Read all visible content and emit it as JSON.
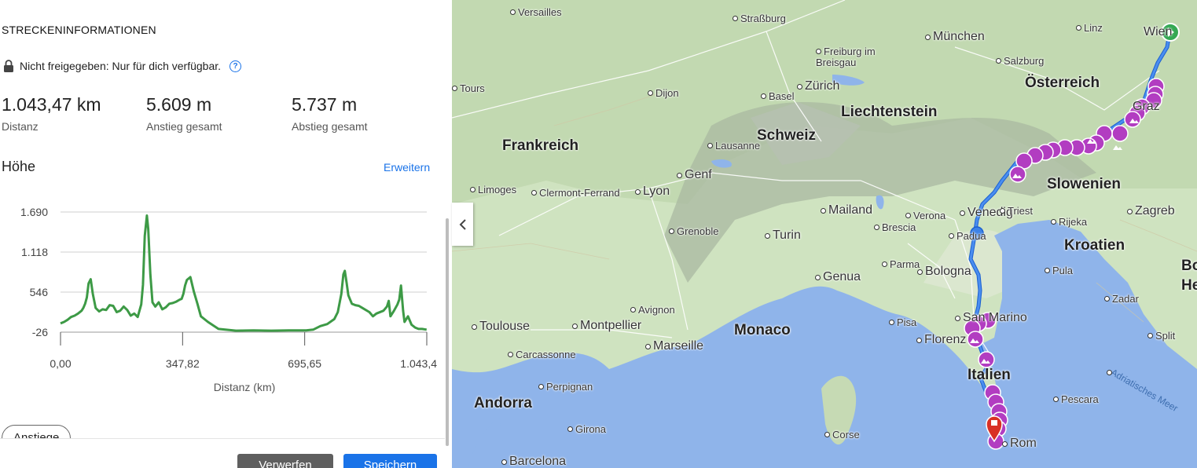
{
  "panel": {
    "section_title": "STRECKENINFORMATIONEN",
    "share_status": "Nicht freigegeben: Nur für dich verfügbar.",
    "help_icon": "?",
    "stats": [
      {
        "value": "1.043,47 km",
        "label": "Distanz"
      },
      {
        "value": "5.609 m",
        "label": "Anstieg gesamt"
      },
      {
        "value": "5.737 m",
        "label": "Abstieg gesamt"
      }
    ],
    "elevation_title": "Höhe",
    "expand_link": "Erweitern",
    "tab_climbs": "Anstiege",
    "discard_button": "Verwerfen",
    "save_button": "Speichern"
  },
  "chart_data": {
    "type": "area",
    "title": "Höhe",
    "xlabel": "Distanz (km)",
    "ylabel": "",
    "x_ticks": [
      "0,00",
      "347,82",
      "695,65",
      "1.043,4"
    ],
    "y_ticks": [
      "1.690",
      "1.118",
      "546",
      "-26"
    ],
    "xlim": [
      0,
      1043.47
    ],
    "ylim": [
      -26,
      1690
    ],
    "color": "#3d9a46",
    "series": [
      {
        "x": [
          0,
          10,
          20,
          30,
          40,
          50,
          60,
          65,
          70,
          75,
          80,
          86,
          92,
          100,
          110,
          120,
          130,
          140,
          150,
          160,
          170,
          180,
          190,
          200,
          210,
          220,
          230,
          235,
          240,
          246,
          250,
          256,
          262,
          270,
          280,
          290,
          300,
          310,
          320,
          330,
          340,
          345,
          350,
          355,
          360,
          370,
          380,
          390,
          400,
          420,
          450,
          500,
          550,
          600,
          650,
          700,
          720,
          740,
          760,
          780,
          790,
          800,
          806,
          810,
          815,
          820,
          830,
          840,
          850,
          860,
          880,
          890,
          900,
          920,
          930,
          935,
          940,
          950,
          960,
          965,
          970,
          976,
          980,
          990,
          1000,
          1010,
          1020,
          1030,
          1043
        ],
        "y": [
          100,
          120,
          150,
          190,
          210,
          240,
          280,
          320,
          380,
          470,
          670,
          730,
          520,
          320,
          270,
          300,
          290,
          360,
          350,
          260,
          280,
          340,
          290,
          210,
          240,
          190,
          370,
          650,
          1350,
          1640,
          1450,
          800,
          400,
          340,
          400,
          300,
          330,
          380,
          390,
          410,
          440,
          450,
          520,
          640,
          720,
          760,
          550,
          380,
          200,
          120,
          20,
          -5,
          0,
          -5,
          0,
          0,
          10,
          60,
          90,
          160,
          260,
          520,
          800,
          850,
          680,
          500,
          380,
          360,
          350,
          320,
          260,
          200,
          240,
          280,
          340,
          420,
          200,
          280,
          370,
          440,
          640,
          280,
          120,
          200,
          80,
          40,
          20,
          20,
          10
        ]
      }
    ]
  },
  "map": {
    "collapse_icon": "chevron-left-icon",
    "labels": [
      {
        "text": "Versailles",
        "kind": "town"
      },
      {
        "text": "Straßburg",
        "kind": "town"
      },
      {
        "text": "München",
        "kind": "city"
      },
      {
        "text": "Linz",
        "kind": "town"
      },
      {
        "text": "Wien",
        "kind": "city"
      },
      {
        "text": "Freiburg im",
        "kind": "town"
      },
      {
        "text": "Breisgau",
        "kind": "town"
      },
      {
        "text": "Salzburg",
        "kind": "town"
      },
      {
        "text": "Tours",
        "kind": "town"
      },
      {
        "text": "Dijon",
        "kind": "town"
      },
      {
        "text": "Basel",
        "kind": "town"
      },
      {
        "text": "Zürich",
        "kind": "city"
      },
      {
        "text": "Österreich",
        "kind": "country"
      },
      {
        "text": "Graz",
        "kind": "city"
      },
      {
        "text": "Liechtenstein",
        "kind": "country"
      },
      {
        "text": "Schweiz",
        "kind": "country"
      },
      {
        "text": "Frankreich",
        "kind": "country"
      },
      {
        "text": "Lausanne",
        "kind": "town"
      },
      {
        "text": "Genf",
        "kind": "city"
      },
      {
        "text": "Limoges",
        "kind": "town"
      },
      {
        "text": "Clermont-Ferrand",
        "kind": "town"
      },
      {
        "text": "Lyon",
        "kind": "city"
      },
      {
        "text": "Slowenien",
        "kind": "country"
      },
      {
        "text": "Zagreb",
        "kind": "city"
      },
      {
        "text": "Mailand",
        "kind": "city"
      },
      {
        "text": "Verona",
        "kind": "town"
      },
      {
        "text": "Venedig",
        "kind": "city"
      },
      {
        "text": "Triest",
        "kind": "town"
      },
      {
        "text": "Rijeka",
        "kind": "town"
      },
      {
        "text": "Grenoble",
        "kind": "town"
      },
      {
        "text": "Turin",
        "kind": "city"
      },
      {
        "text": "Brescia",
        "kind": "town"
      },
      {
        "text": "Padua",
        "kind": "town"
      },
      {
        "text": "Kroatien",
        "kind": "country"
      },
      {
        "text": "Bo",
        "kind": "country"
      },
      {
        "text": "He",
        "kind": "country"
      },
      {
        "text": "Genua",
        "kind": "city"
      },
      {
        "text": "Parma",
        "kind": "town"
      },
      {
        "text": "Bologna",
        "kind": "city"
      },
      {
        "text": "Pula",
        "kind": "town"
      },
      {
        "text": "Avignon",
        "kind": "town"
      },
      {
        "text": "Zadar",
        "kind": "town"
      },
      {
        "text": "Toulouse",
        "kind": "city"
      },
      {
        "text": "Montpellier",
        "kind": "city"
      },
      {
        "text": "Monaco",
        "kind": "country"
      },
      {
        "text": "Pisa",
        "kind": "town"
      },
      {
        "text": "San Marino",
        "kind": "city"
      },
      {
        "text": "Marseille",
        "kind": "city"
      },
      {
        "text": "Florenz",
        "kind": "city"
      },
      {
        "text": "Split",
        "kind": "town"
      },
      {
        "text": "Carcassonne",
        "kind": "town"
      },
      {
        "text": "Italien",
        "kind": "country"
      },
      {
        "text": "Perpignan",
        "kind": "town"
      },
      {
        "text": "Adriatisches Meer",
        "kind": "sea"
      },
      {
        "text": "Andorra",
        "kind": "country"
      },
      {
        "text": "Pescara",
        "kind": "town"
      },
      {
        "text": "Girona",
        "kind": "town"
      },
      {
        "text": "Corse",
        "kind": "town"
      },
      {
        "text": "Rom",
        "kind": "city"
      },
      {
        "text": "Barcelona",
        "kind": "city"
      }
    ]
  }
}
